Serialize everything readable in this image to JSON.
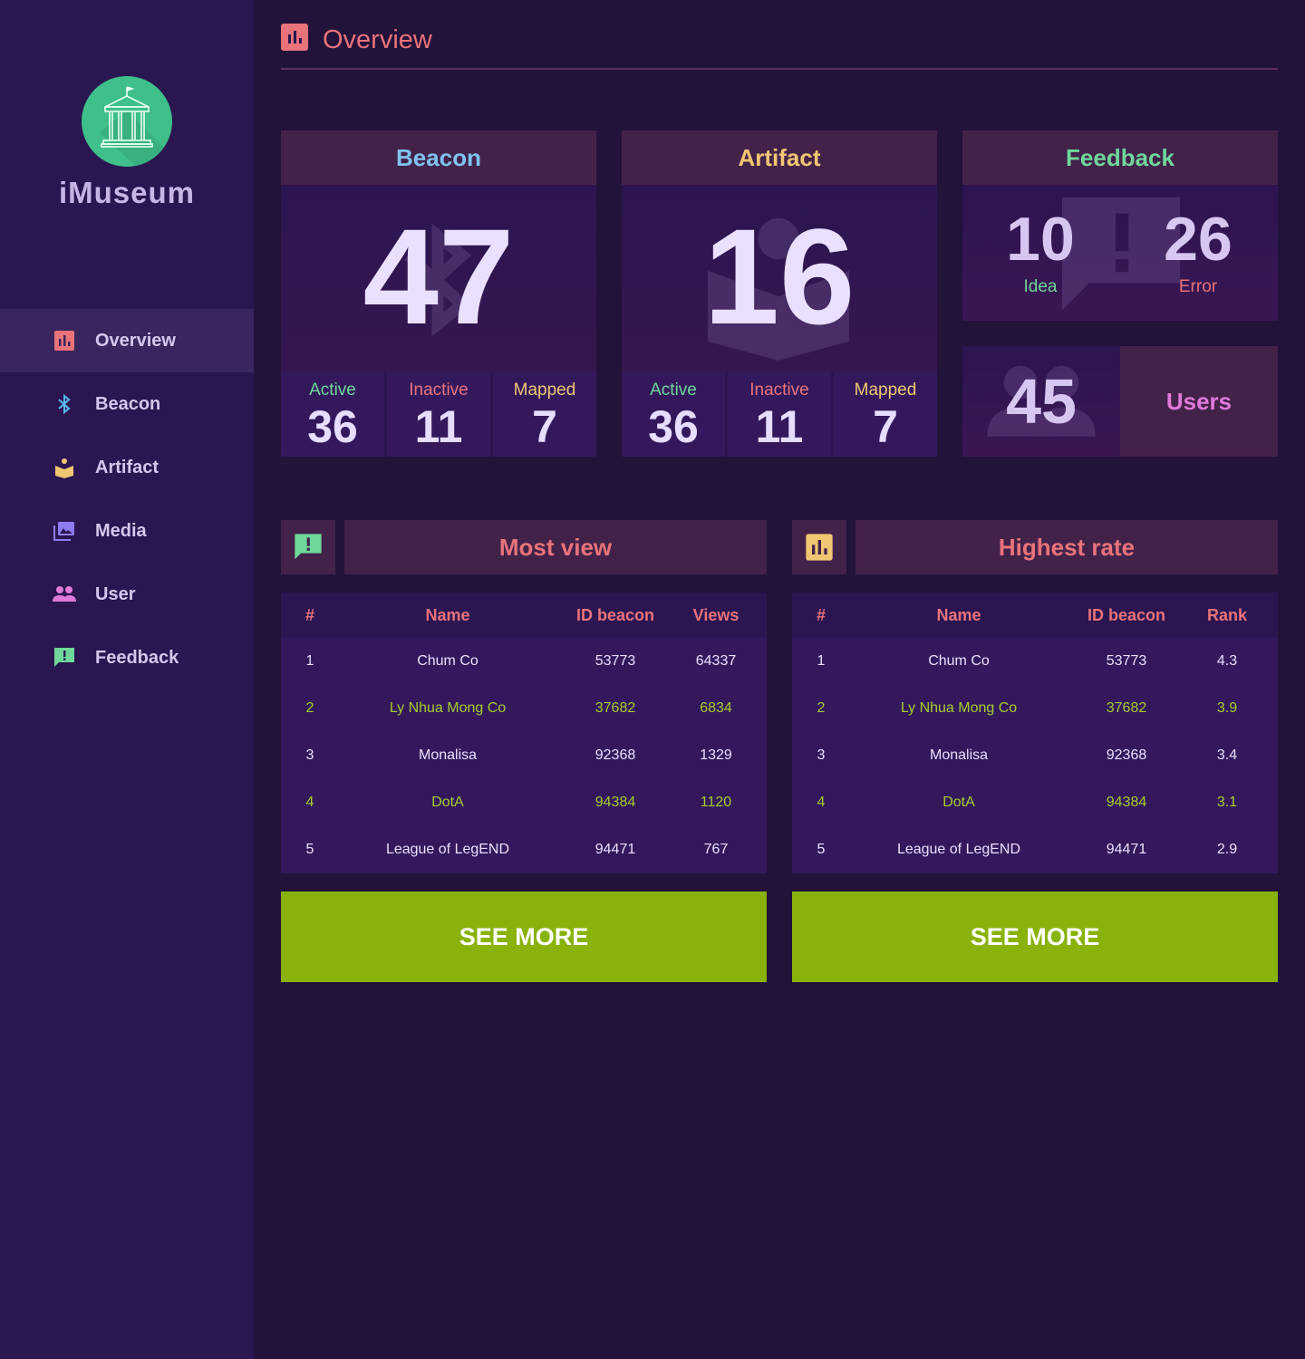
{
  "brand": {
    "name": "iMuseum"
  },
  "nav": [
    {
      "label": "Overview",
      "icon": "bar-chart-icon"
    },
    {
      "label": "Beacon",
      "icon": "bluetooth-icon"
    },
    {
      "label": "Artifact",
      "icon": "reader-icon"
    },
    {
      "label": "Media",
      "icon": "photo-library-icon"
    },
    {
      "label": "User",
      "icon": "people-icon"
    },
    {
      "label": "Feedback",
      "icon": "feedback-icon"
    }
  ],
  "header": {
    "title": "Overview"
  },
  "beacon": {
    "title": "Beacon",
    "total": "47",
    "stats": [
      {
        "label": "Active",
        "value": "36"
      },
      {
        "label": "Inactive",
        "value": "11"
      },
      {
        "label": "Mapped",
        "value": "7"
      }
    ]
  },
  "artifact": {
    "title": "Artifact",
    "total": "16",
    "stats": [
      {
        "label": "Active",
        "value": "36"
      },
      {
        "label": "Inactive",
        "value": "11"
      },
      {
        "label": "Mapped",
        "value": "7"
      }
    ]
  },
  "feedback": {
    "title": "Feedback",
    "idea": {
      "value": "10",
      "label": "Idea"
    },
    "error": {
      "value": "26",
      "label": "Error"
    }
  },
  "users": {
    "count": "45",
    "label": "Users"
  },
  "most_view": {
    "title": "Most view",
    "columns": [
      "#",
      "Name",
      "ID beacon",
      "Views"
    ],
    "rows": [
      [
        "1",
        "Chum Co",
        "53773",
        "64337"
      ],
      [
        "2",
        "Ly Nhua Mong Co",
        "37682",
        "6834"
      ],
      [
        "3",
        "Monalisa",
        "92368",
        "1329"
      ],
      [
        "4",
        "DotA",
        "94384",
        "1120"
      ],
      [
        "5",
        "League of LegEND",
        "94471",
        "767"
      ]
    ],
    "button": "SEE MORE"
  },
  "highest_rate": {
    "title": "Highest rate",
    "columns": [
      "#",
      "Name",
      "ID beacon",
      "Rank"
    ],
    "rows": [
      [
        "1",
        "Chum Co",
        "53773",
        "4.3"
      ],
      [
        "2",
        "Ly Nhua Mong Co",
        "37682",
        "3.9"
      ],
      [
        "3",
        "Monalisa",
        "92368",
        "3.4"
      ],
      [
        "4",
        "DotA",
        "94384",
        "3.1"
      ],
      [
        "5",
        "League of LegEND",
        "94471",
        "2.9"
      ]
    ],
    "button": "SEE MORE"
  },
  "colors": {
    "beacon_title": "#7ec3ee",
    "artifact_title": "#f0c772",
    "feedback_title": "#6fd79a",
    "active": "#6fd79a",
    "inactive": "#e8737a",
    "mapped": "#f0c772",
    "accent_red": "#e8737a",
    "see_more_bg": "#89b20b",
    "alt_row_text": "#a8cc2a"
  }
}
